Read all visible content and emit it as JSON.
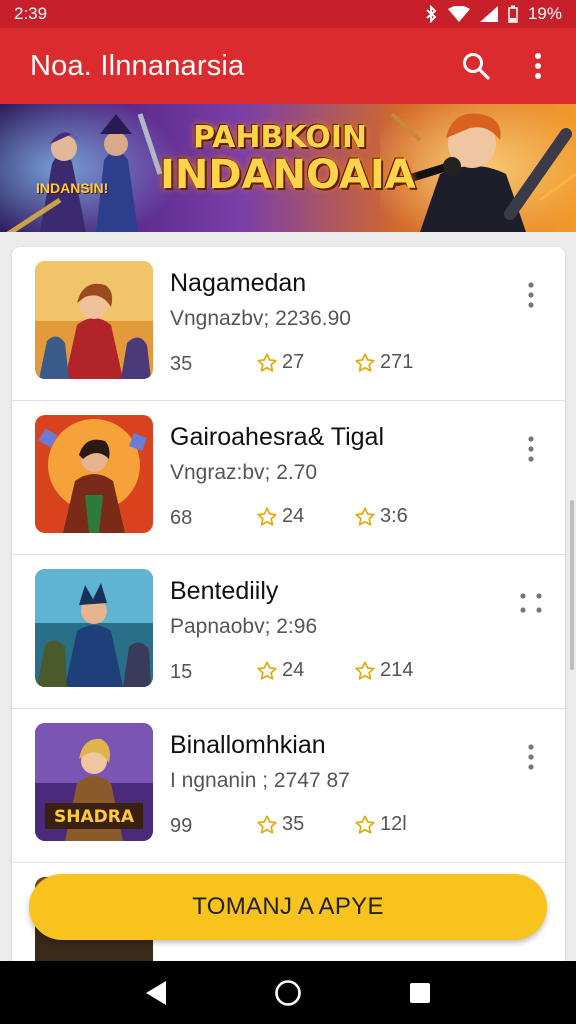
{
  "status_bar": {
    "time": "2:39",
    "battery": "19%"
  },
  "app_bar": {
    "title": "Noa. Ilnnanarsia",
    "icons": [
      "search-icon",
      "more-vert-icon"
    ]
  },
  "banner": {
    "line1": "PAHBKOIN",
    "line2": "INDANOAIA",
    "small_text": "INDANSIN!"
  },
  "items": [
    {
      "title": "Nagamedan",
      "subtitle": "Vngnazbv;  2236.90",
      "count": "35",
      "stat_a": "27",
      "stat_b": "271"
    },
    {
      "title": "Gairoahesra& Tigal",
      "subtitle": "Vngraz:bv;  2.70",
      "count": "68",
      "stat_a": "24",
      "stat_b": "3:6"
    },
    {
      "title": "Bentediily",
      "subtitle": "Papnaobv;  2:96",
      "count": "15",
      "stat_a": "24",
      "stat_b": "214"
    },
    {
      "title": "Binallomhkian",
      "subtitle": "I ngnanin ;  2747 87",
      "count": "99",
      "stat_a": "35",
      "stat_b": "12l"
    }
  ],
  "thumb_badge": "SHADRA",
  "cta_label": "TOMANJ A APYE",
  "colors": {
    "app_bar": "#dc2b2f",
    "status_bar": "#c8202a",
    "cta": "#f7c31c",
    "star": "#e0a800"
  }
}
